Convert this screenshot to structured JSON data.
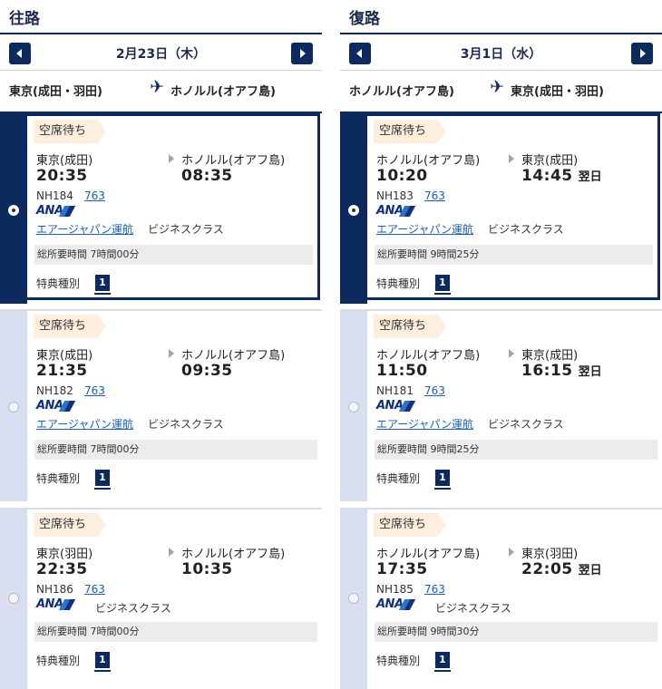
{
  "outbound": {
    "title": "往路",
    "date": "2月23日（木）",
    "from": "東京(成田・羽田)",
    "to": "ホノルル(オアフ島)",
    "flights": [
      {
        "status": "空席待ち",
        "dep_city": "東京(成田)",
        "arr_city": "ホノルル(オアフ島)",
        "dep_time": "20:35",
        "arr_time": "08:35",
        "next_day": "",
        "flight_no": "NH184",
        "equipment": "763",
        "airline_logo": "ANA",
        "operator": "エアージャパン運航",
        "cabin": "ビジネスクラス",
        "duration": "総所要時間 7時間00分",
        "award_label": "特典種別",
        "award_type": "1",
        "selected": true
      },
      {
        "status": "空席待ち",
        "dep_city": "東京(成田)",
        "arr_city": "ホノルル(オアフ島)",
        "dep_time": "21:35",
        "arr_time": "09:35",
        "next_day": "",
        "flight_no": "NH182",
        "equipment": "763",
        "airline_logo": "ANA",
        "operator": "エアージャパン運航",
        "cabin": "ビジネスクラス",
        "duration": "総所要時間 7時間00分",
        "award_label": "特典種別",
        "award_type": "1",
        "selected": false
      },
      {
        "status": "空席待ち",
        "dep_city": "東京(羽田)",
        "arr_city": "ホノルル(オアフ島)",
        "dep_time": "22:35",
        "arr_time": "10:35",
        "next_day": "",
        "flight_no": "NH186",
        "equipment": "763",
        "airline_logo": "ANA",
        "operator": "",
        "cabin": "ビジネスクラス",
        "duration": "総所要時間 7時間00分",
        "award_label": "特典種別",
        "award_type": "1",
        "selected": false
      }
    ]
  },
  "return": {
    "title": "復路",
    "date": "3月1日（水）",
    "from": "ホノルル(オアフ島)",
    "to": "東京(成田・羽田)",
    "flights": [
      {
        "status": "空席待ち",
        "dep_city": "ホノルル(オアフ島)",
        "arr_city": "東京(成田)",
        "dep_time": "10:20",
        "arr_time": "14:45",
        "next_day": "翌日",
        "flight_no": "NH183",
        "equipment": "763",
        "airline_logo": "ANA",
        "operator": "エアージャパン運航",
        "cabin": "ビジネスクラス",
        "duration": "総所要時間 9時間25分",
        "award_label": "特典種別",
        "award_type": "1",
        "selected": true
      },
      {
        "status": "空席待ち",
        "dep_city": "ホノルル(オアフ島)",
        "arr_city": "東京(成田)",
        "dep_time": "11:50",
        "arr_time": "16:15",
        "next_day": "翌日",
        "flight_no": "NH181",
        "equipment": "763",
        "airline_logo": "ANA",
        "operator": "エアージャパン運航",
        "cabin": "ビジネスクラス",
        "duration": "総所要時間 9時間25分",
        "award_label": "特典種別",
        "award_type": "1",
        "selected": false
      },
      {
        "status": "空席待ち",
        "dep_city": "ホノルル(オアフ島)",
        "arr_city": "東京(羽田)",
        "dep_time": "17:35",
        "arr_time": "22:05",
        "next_day": "翌日",
        "flight_no": "NH185",
        "equipment": "763",
        "airline_logo": "ANA",
        "operator": "",
        "cabin": "ビジネスクラス",
        "duration": "総所要時間 9時間30分",
        "award_label": "特典種別",
        "award_type": "1",
        "selected": false
      }
    ]
  },
  "colors": {
    "primary": "#0d2a5e",
    "rail_light": "#d6def0",
    "badge_bg": "#fdeedd",
    "link": "#1b5fb3"
  },
  "icons": {
    "prev": "chevron-left-icon",
    "next": "chevron-right-icon",
    "plane": "airplane-icon"
  }
}
